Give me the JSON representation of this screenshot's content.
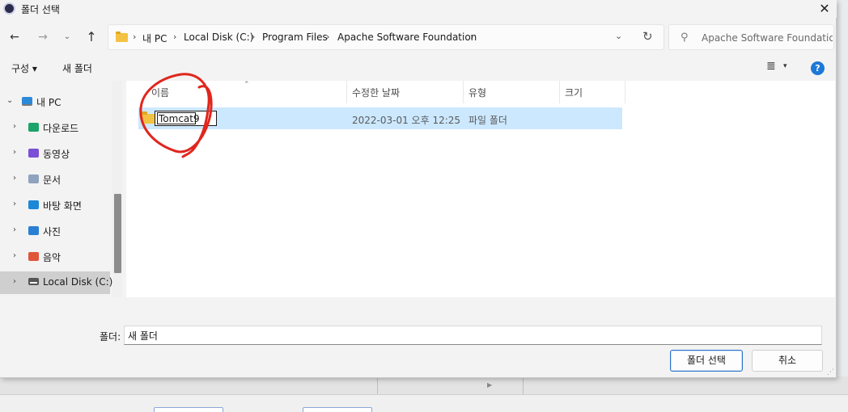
{
  "window": {
    "title": "폴더 선택",
    "close_glyph": "✕"
  },
  "nav_buttons": {
    "back": "←",
    "forward": "→",
    "recent": "⌄",
    "up": "↑"
  },
  "address": {
    "crumbs": [
      "내 PC",
      "Local Disk (C:)",
      "Program Files",
      "Apache Software Foundation"
    ],
    "separator": "›",
    "dropdown_glyph": "⌄",
    "refresh_glyph": "↻"
  },
  "search": {
    "placeholder": "Apache Software Foundatio...",
    "icon_glyph": "⚲"
  },
  "toolbar": {
    "organize_label": "구성 ▾",
    "new_folder_label": "새 폴더",
    "view_glyph": "≣",
    "view_caret": "▾",
    "help_glyph": "?"
  },
  "nav_pane": {
    "items": [
      {
        "label": "내 PC",
        "chevron": "⌄"
      },
      {
        "label": "다운로드",
        "chevron": "›",
        "color": "#1aa36a"
      },
      {
        "label": "동영상",
        "chevron": "›",
        "color": "#7b4fd6"
      },
      {
        "label": "문서",
        "chevron": "›",
        "color": "#8fa3bf"
      },
      {
        "label": "바탕 화면",
        "chevron": "›",
        "color": "#1e88d8"
      },
      {
        "label": "사진",
        "chevron": "›",
        "color": "#2a7fd4"
      },
      {
        "label": "음악",
        "chevron": "›",
        "color": "#e0563b"
      },
      {
        "label": "Local Disk (C:)",
        "chevron": "›"
      }
    ]
  },
  "file_list": {
    "columns": [
      "이름",
      "수정한 날짜",
      "유형",
      "크기"
    ],
    "sort_glyph": "⌃",
    "rows": [
      {
        "name": "Tomcat9",
        "modified": "2022-03-01 오후 12:25",
        "type": "파일 폴더",
        "size": ""
      }
    ]
  },
  "footer": {
    "folder_label": "폴더:",
    "folder_value": "새 폴더",
    "select_button": "폴더 선택",
    "cancel_button": "취소"
  },
  "colors": {
    "accent": "#1e78d6",
    "selection": "#cce8ff",
    "annotation": "#e0261d"
  }
}
